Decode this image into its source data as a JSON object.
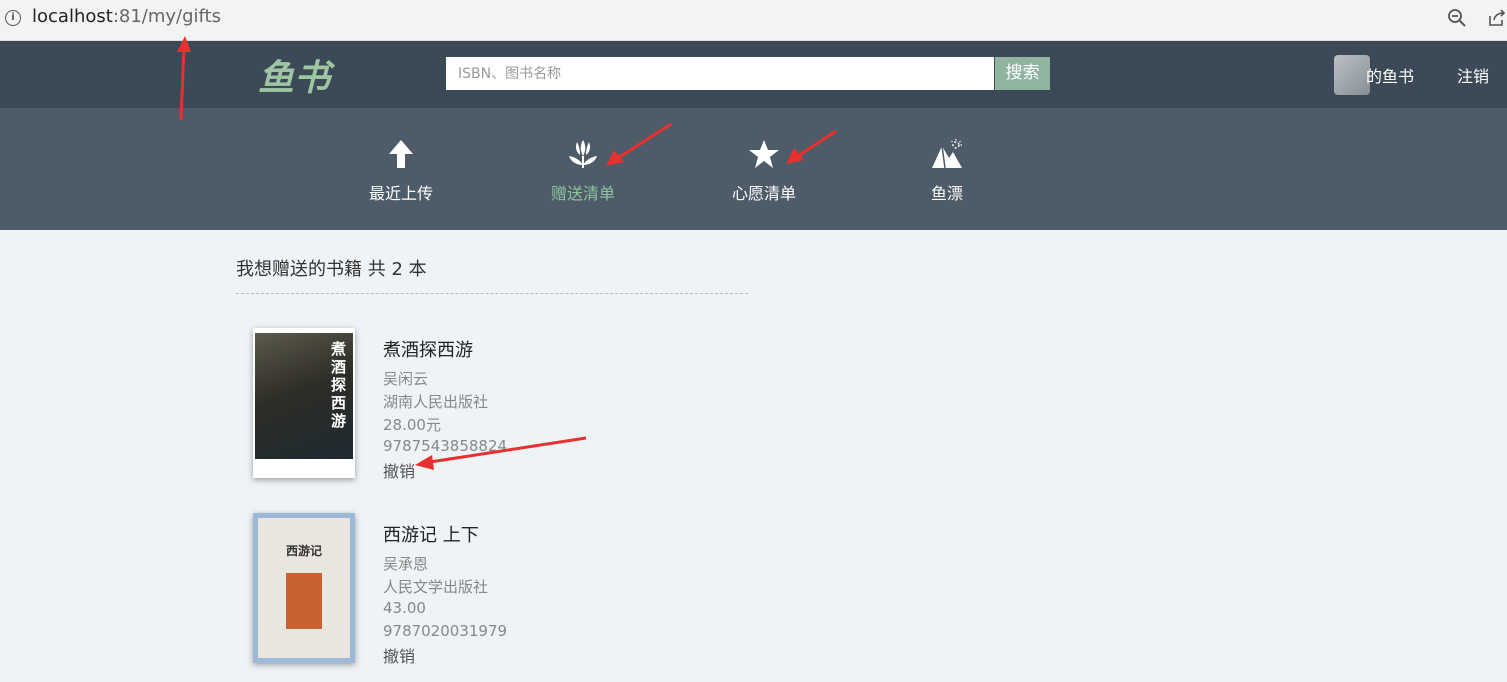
{
  "browser": {
    "url_host": "localhost",
    "url_path": ":81/my/gifts"
  },
  "header": {
    "logo_text": "鱼书",
    "search_placeholder": "ISBN、图书名称",
    "search_button": "搜索",
    "my_books": "的鱼书",
    "logout": "注销"
  },
  "nav": {
    "items": [
      {
        "label": "最近上传",
        "icon": "upload-arrow-icon"
      },
      {
        "label": "赠送清单",
        "icon": "flower-icon",
        "active": true
      },
      {
        "label": "心愿清单",
        "icon": "star-icon"
      },
      {
        "label": "鱼漂",
        "icon": "mountain-icon"
      }
    ]
  },
  "main": {
    "heading": "我想赠送的书籍 共 2 本",
    "books": [
      {
        "title": "煮酒探西游",
        "author": "吴闲云",
        "publisher": "湖南人民出版社",
        "price": "28.00元",
        "isbn": "9787543858824",
        "action": "撤销",
        "cover_text": "煮酒探西游"
      },
      {
        "title": "西游记 上下",
        "author": "吴承恩",
        "publisher": "人民文学出版社",
        "price": "43.00",
        "isbn": "9787020031979",
        "action": "撤销",
        "cover_text": "西游记"
      }
    ]
  },
  "colors": {
    "header_bg": "#3b4a56",
    "nav_bg": "#4d5c68",
    "accent_green": "#8fc3a1",
    "search_button_bg": "#8fb5a1",
    "annotation_red": "#e8302f"
  }
}
